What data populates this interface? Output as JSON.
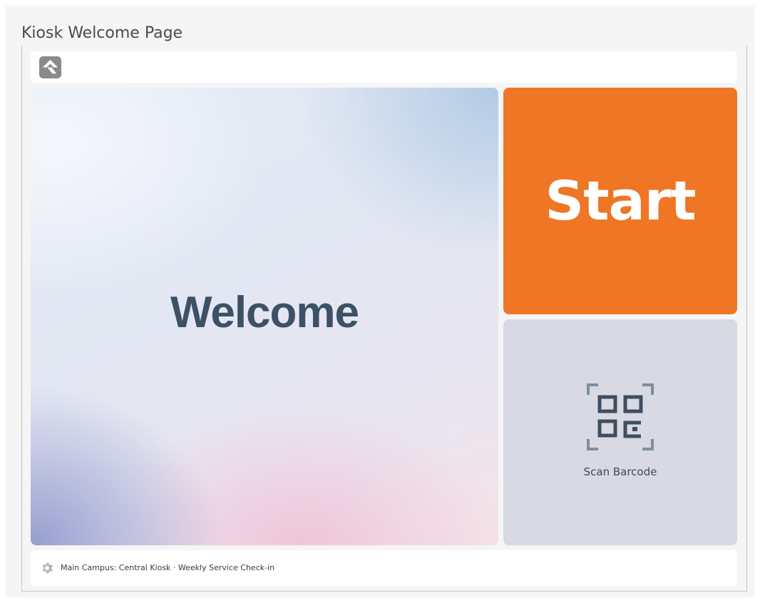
{
  "page": {
    "title": "Kiosk Welcome Page"
  },
  "header": {
    "logo_icon": "rock-logo-icon"
  },
  "welcome": {
    "text": "Welcome"
  },
  "actions": {
    "start_label": "Start",
    "scan_label": "Scan Barcode",
    "scan_icon": "qr-scan-icon"
  },
  "footer": {
    "icon": "gear-icon",
    "status_text": "Main Campus: Central Kiosk · Weekly Service Check-in"
  },
  "colors": {
    "start_button": "#ee7625",
    "scan_button": "#d8d9e3",
    "welcome_text": "#3d5166",
    "icon_gray": "#8a8a8a"
  }
}
